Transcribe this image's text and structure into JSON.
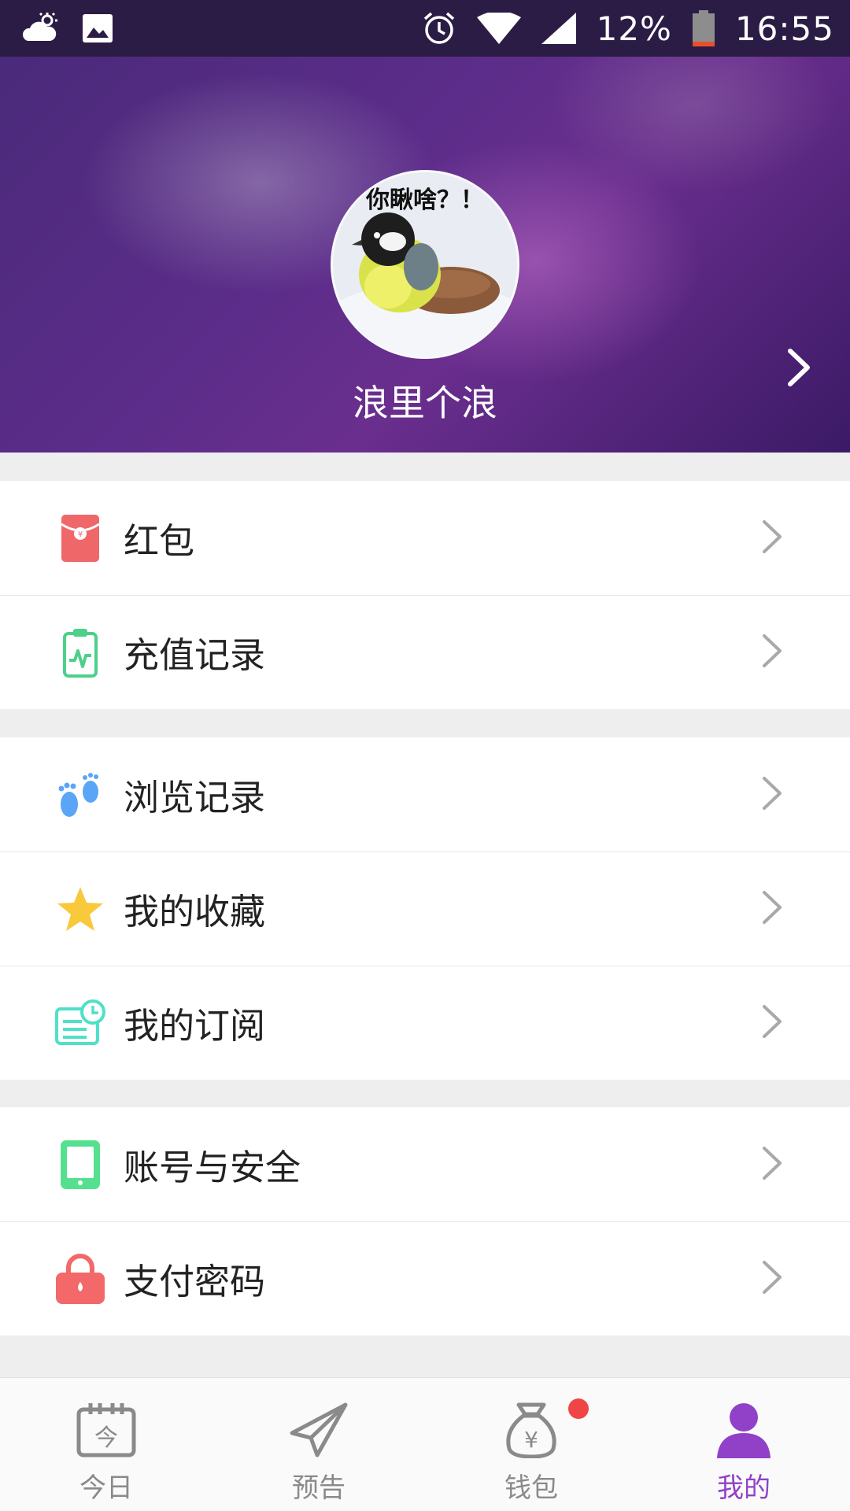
{
  "status_bar": {
    "battery": "12%",
    "time": "16:55",
    "icons": [
      "weather-icon",
      "image-icon",
      "alarm-icon",
      "wifi-icon",
      "signal-icon",
      "battery-icon"
    ]
  },
  "profile": {
    "avatar_caption": "你瞅啥？！",
    "username": "浪里个浪"
  },
  "menu_groups": [
    {
      "items": [
        {
          "label": "红包",
          "icon": "red-envelope-icon",
          "color": "#f0676a"
        },
        {
          "label": "充值记录",
          "icon": "clipboard-chart-icon",
          "color": "#4cd08a"
        }
      ]
    },
    {
      "items": [
        {
          "label": "浏览记录",
          "icon": "footprints-icon",
          "color": "#5aa5f5"
        },
        {
          "label": "我的收藏",
          "icon": "star-icon",
          "color": "#f8c93a"
        },
        {
          "label": "我的订阅",
          "icon": "subscription-clock-icon",
          "color": "#4fe0c9"
        }
      ]
    },
    {
      "items": [
        {
          "label": "账号与安全",
          "icon": "phone-icon",
          "color": "#55e08f"
        },
        {
          "label": "支付密码",
          "icon": "lock-icon",
          "color": "#f36868"
        }
      ]
    }
  ],
  "bottom_nav": [
    {
      "label": "今日",
      "icon": "calendar-today-icon",
      "active": false
    },
    {
      "label": "预告",
      "icon": "paper-plane-icon",
      "active": false
    },
    {
      "label": "钱包",
      "icon": "money-bag-icon",
      "active": false,
      "badge": true
    },
    {
      "label": "我的",
      "icon": "user-icon",
      "active": true
    }
  ],
  "colors": {
    "accent": "#9141c8",
    "inactive": "#8a8a8a",
    "badge": "#f04545"
  }
}
